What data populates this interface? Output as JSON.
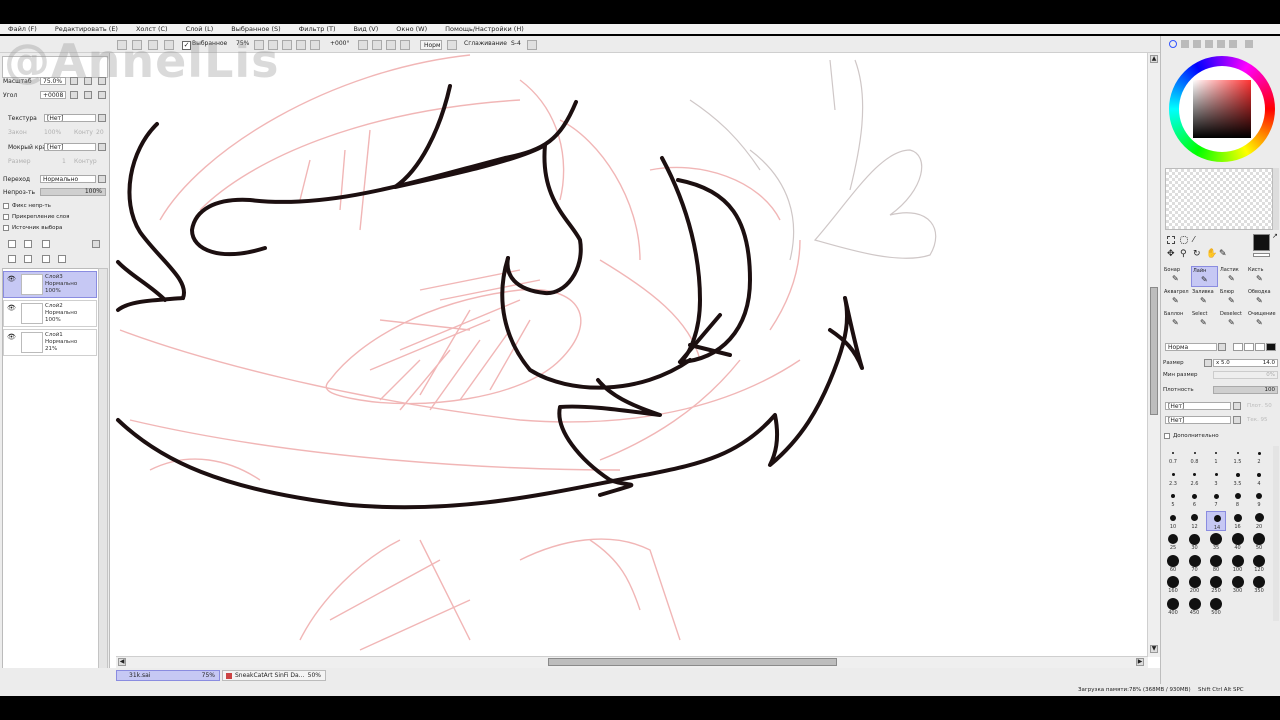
{
  "menu": [
    "Файл (F)",
    "Редактировать (E)",
    "Холст (C)",
    "Слой (L)",
    "Выбранное (S)",
    "Фильтр (T)",
    "Вид (V)",
    "Окно (W)",
    "Помощь/Настройки (H)"
  ],
  "toolbar": {
    "selection_label": "Выбранное",
    "zoom_value": "75%",
    "angle_value": "+000°",
    "mode_label": "Норм",
    "smoothing_label": "Сглаживание",
    "smoothing_value": "S-4"
  },
  "watermark": "@AnnelLis",
  "navigator": {
    "scale_label": "Масштаб",
    "scale_value": "75.0%",
    "angle_label": "Угол",
    "angle_value": "+0008"
  },
  "texture": {
    "texture_label": "Текстура",
    "texture_value": "[Нет]",
    "scale_label": "Закон",
    "scale_value": "100%",
    "strength_label": "Конту",
    "strength_value": "20",
    "wet_edge_label": "Мокрый край",
    "wet_edge_value": "[Нет]",
    "size_label": "Размер",
    "size_value": "1",
    "contour_label": "Контур"
  },
  "layer_props": {
    "blend_label": "Переход",
    "blend_value": "Нормально",
    "opacity_label": "Непроз-ть",
    "opacity_value": "100%",
    "opts": [
      "Фикс непр-ть",
      "Прикрепление слоя",
      "Источник выбора"
    ]
  },
  "layers": [
    {
      "name": "Слой3",
      "mode": "Нормально",
      "opacity": "100%",
      "selected": true
    },
    {
      "name": "Слой2",
      "mode": "Нормально",
      "opacity": "100%",
      "selected": false
    },
    {
      "name": "Слой1",
      "mode": "Нормально",
      "opacity": "21%",
      "selected": false
    }
  ],
  "status_tabs": [
    {
      "name": "31k.sai",
      "zoom": "75%"
    },
    {
      "name": "SneakCatArt SinFi Da...",
      "zoom": "50%"
    }
  ],
  "memory_status": "Загрузка памяти:78% (368MB / 930MB)",
  "key_indicators": "Shift Ctrl Alt SPC",
  "brush_tabs": [
    "Бонар",
    "Лайн",
    "Ластик",
    "Кисть",
    "Аквагрел",
    "Заливка",
    "Блюр",
    "Обводка",
    "Баллон",
    "Select",
    "Deselect",
    "Очищение"
  ],
  "brush": {
    "mode_value": "Норма",
    "size_label": "Размер",
    "size_mult": "x 5.0",
    "size_value": "14.0",
    "min_size_label": "Мин размер",
    "min_size_value": "0%",
    "density_label": "Плотность",
    "density_value": "100",
    "shape1": "[Нет]",
    "shape1_right": "Плот. 50",
    "shape2": "[Нет]",
    "shape2_right": "Тек. 95",
    "extra_label": "Дополнительно"
  },
  "brush_sizes": [
    "0.7",
    "0.8",
    "1",
    "1.5",
    "2",
    "2.3",
    "2.6",
    "3",
    "3.5",
    "4",
    "5",
    "6",
    "7",
    "8",
    "9",
    "10",
    "12",
    "14",
    "16",
    "20",
    "25",
    "30",
    "35",
    "40",
    "50",
    "60",
    "70",
    "80",
    "100",
    "120",
    "160",
    "200",
    "250",
    "300",
    "350",
    "400",
    "450",
    "500"
  ],
  "selected_size": "14",
  "colors": {
    "accent": "#c6c8f4",
    "current_color": "#111111",
    "panel": "#ececec"
  }
}
